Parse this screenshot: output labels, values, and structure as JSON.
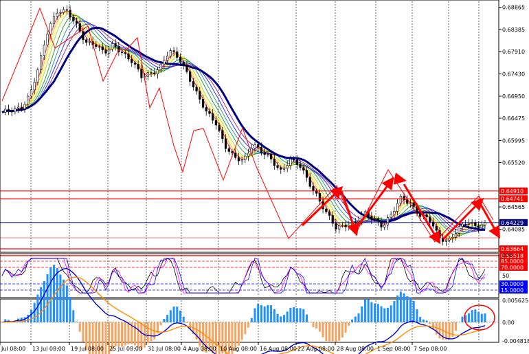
{
  "chart_data": [
    {
      "type": "candlestick",
      "pane": "price",
      "y_axis_ticks": [
        "0.68865",
        "0.68385",
        "0.67910",
        "0.67430",
        "0.66950",
        "0.66475",
        "0.65995",
        "0.65520",
        "0.64565",
        "0.64085"
      ],
      "x_axis_ticks": [
        "Jul 08:00",
        "13 Jul 08:00",
        "19 Jul 08:00",
        "25 Jul 08:00",
        "31 Jul 08:00",
        "4 Aug 08:00",
        "10 Aug 08:00",
        "16 Aug 08:00",
        "22 Aug 08:00",
        "28 Aug 08:00",
        "1 Sep 08:00",
        "7 Sep 08:00"
      ],
      "ylim": [
        0.6362,
        0.6899
      ],
      "close_path": [
        0.666,
        0.6662,
        0.667,
        0.67,
        0.676,
        0.684,
        0.6882,
        0.6878,
        0.6845,
        0.6812,
        0.681,
        0.6785,
        0.6805,
        0.679,
        0.677,
        0.6735,
        0.6745,
        0.6758,
        0.679,
        0.6778,
        0.6745,
        0.6698,
        0.6658,
        0.664,
        0.659,
        0.656,
        0.6555,
        0.6595,
        0.6575,
        0.6555,
        0.6535,
        0.656,
        0.6545,
        0.651,
        0.648,
        0.644,
        0.6408,
        0.642,
        0.6425,
        0.644,
        0.643,
        0.6418,
        0.6442,
        0.6475,
        0.6465,
        0.644,
        0.6428,
        0.6392,
        0.6385,
        0.6405,
        0.6422,
        0.6418,
        0.642
      ],
      "moving_averages": [
        "red",
        "orange",
        "yellow",
        "yellowgreen",
        "green",
        "teal",
        "blue",
        "purple",
        "navy"
      ],
      "level_tags": [
        {
          "value": 0.6491,
          "label": "0.64910",
          "color": "#ff0000"
        },
        {
          "value": 0.64741,
          "label": "0.64741",
          "color": "#ff0000"
        },
        {
          "value": 0.64229,
          "label": "0.64229",
          "color": "#000080"
        },
        {
          "value": 0.63664,
          "label": "0.63664",
          "color": "#ff0000"
        },
        {
          "value": 0.63518,
          "label": "0.63518",
          "color": "#ff0000"
        }
      ]
    },
    {
      "type": "line",
      "pane": "oscillator",
      "ylim": [
        0,
        100
      ],
      "y_axis_ticks": [
        "100",
        "50"
      ],
      "levels": [
        {
          "value": 85,
          "label": "85.0000",
          "color": "#ff0000"
        },
        {
          "value": 70,
          "label": "70.0000",
          "color": "#ff0000"
        },
        {
          "value": 30,
          "label": "30.0000",
          "color": "#0000ff"
        },
        {
          "value": 15,
          "label": "15.0000",
          "color": "#0000ff"
        }
      ]
    },
    {
      "type": "bar",
      "pane": "macd",
      "ylim": [
        -0.004818,
        0.005625
      ],
      "y_axis_ticks": [
        "0.005625",
        "0.00",
        "-0.004818"
      ],
      "hist_positive_color": "#1e90ff",
      "hist_negative_color": "#f4a460",
      "line_colors": [
        "#0000cd",
        "#ff8c00"
      ]
    }
  ]
}
